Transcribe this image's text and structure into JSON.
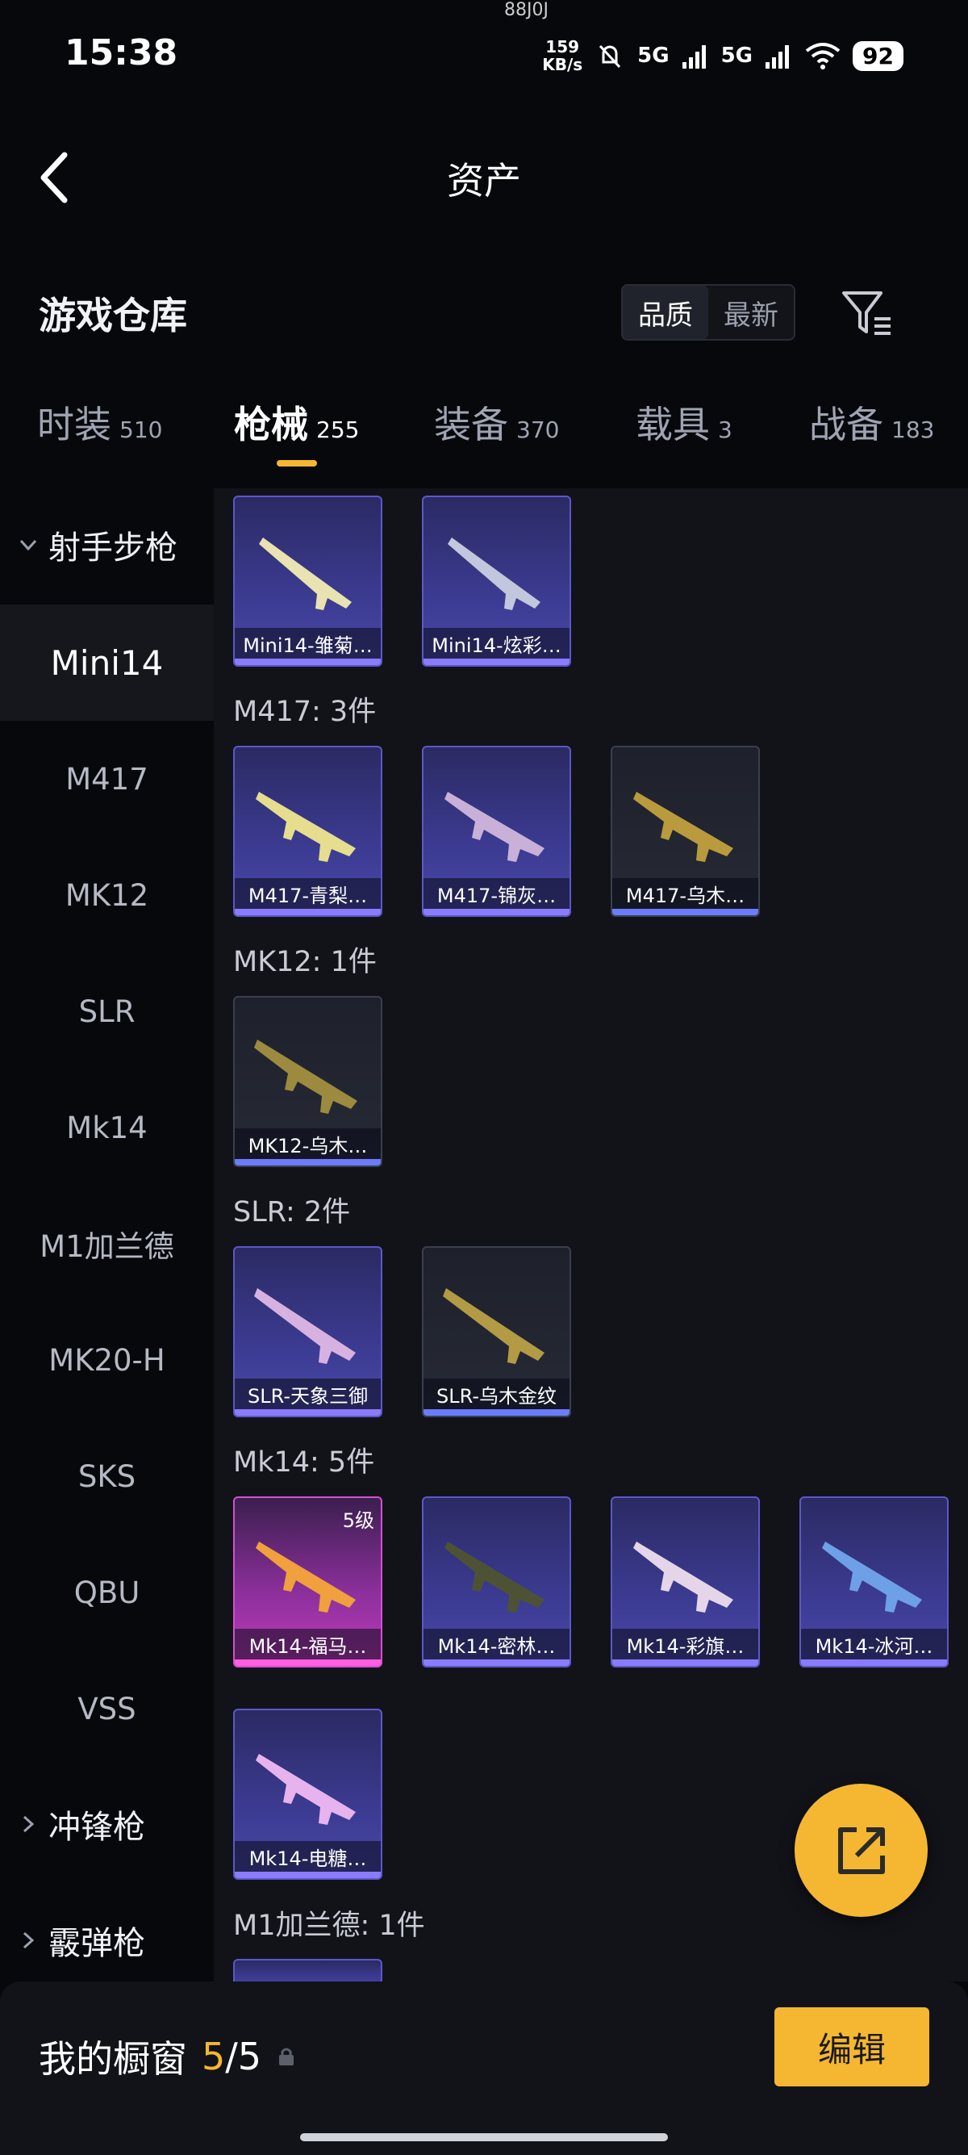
{
  "status_bar": {
    "time": "15:38",
    "net_speed_value": "159",
    "net_speed_unit": "KB/s",
    "signal1": "5G",
    "signal2": "5G",
    "battery": "92",
    "top_mark": "88J0J"
  },
  "header": {
    "title": "资产"
  },
  "warehouse": {
    "title": "游戏仓库",
    "sort_options": [
      "品质",
      "最新"
    ]
  },
  "tabs": [
    {
      "label": "时装",
      "count": "510"
    },
    {
      "label": "枪械",
      "count": "255"
    },
    {
      "label": "装备",
      "count": "370"
    },
    {
      "label": "载具",
      "count": "3"
    },
    {
      "label": "战备",
      "count": "183"
    }
  ],
  "sidebar": {
    "group_rifle": "射手步枪",
    "items": [
      "Mini14",
      "M417",
      "MK12",
      "SLR",
      "Mk14",
      "M1加兰德",
      "MK20-H",
      "SKS",
      "QBU",
      "VSS"
    ],
    "group_smg": "冲锋枪",
    "group_shotgun": "霰弹枪"
  },
  "content": {
    "groups": [
      {
        "label": "M417: 3件"
      },
      {
        "label": "MK12: 1件"
      },
      {
        "label": "SLR: 2件"
      },
      {
        "label": "Mk14: 5件"
      },
      {
        "label": "M1加兰德: 1件"
      }
    ],
    "cards": {
      "mini14_1": "Mini14-雏菊…",
      "mini14_2": "Mini14-炫彩…",
      "m417_1": "M417-青梨…",
      "m417_2": "M417-锦灰…",
      "m417_3": "M417-乌木…",
      "mk12_1": "MK12-乌木…",
      "slr_1": "SLR-天象三御",
      "slr_2": "SLR-乌木金纹",
      "mk14_1": "Mk14-福马…",
      "mk14_1_level": "5级",
      "mk14_2": "Mk14-密林…",
      "mk14_3": "Mk14-彩旗…",
      "mk14_4": "Mk14-冰河…",
      "mk14_5": "Mk14-电糖…"
    }
  },
  "bottom_bar": {
    "label": "我的橱窗",
    "current": "5",
    "separator": "/",
    "total": "5",
    "edit_label": "编辑"
  },
  "colors": {
    "accent": "#f5b731",
    "background": "#07080c",
    "panel": "#111319"
  }
}
